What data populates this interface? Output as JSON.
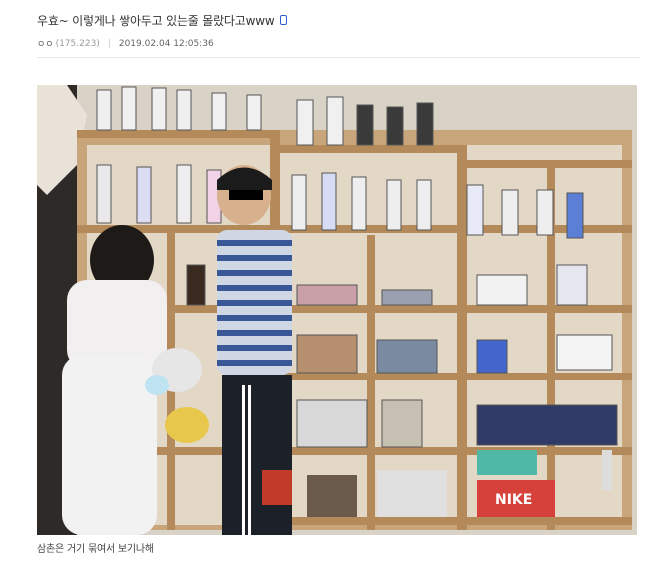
{
  "post": {
    "title": "우효~ 이렇게나 쌓아두고 있는줄 몰랐다고www",
    "author": "ㅇㅇ",
    "author_points": "(175.223)",
    "separator": "|",
    "datetime": "2019.02.04 12:05:36",
    "mobile_icon": "mobile-phone-icon",
    "caption": "삼촌은 거기 묶여서 보기나해"
  },
  "photo": {
    "box_brand_text": "NIKE",
    "colors": {
      "accent_icon": "#2f5ecb",
      "nike_box": "#d6413b",
      "shelf_wood": "#c8a57a"
    }
  }
}
